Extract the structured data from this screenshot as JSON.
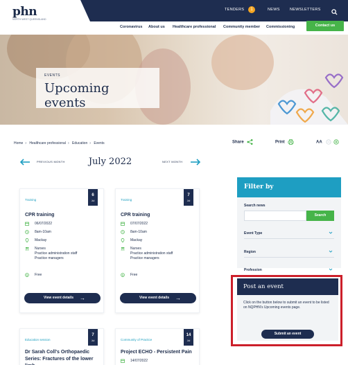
{
  "brand": {
    "logo_text": "phn",
    "logo_sub": "NORTH WEST QUEENSLAND"
  },
  "topbar": {
    "tenders_label": "TENDERS",
    "tenders_badge": "1",
    "news_label": "NEWS",
    "newsletters_label": "NEWSLETTERS"
  },
  "nav": {
    "items": [
      "Coronavirus",
      "About us",
      "Healthcare professional",
      "Community member",
      "Commissioning"
    ],
    "contact_label": "Contact us"
  },
  "hero": {
    "kicker": "EVENTS",
    "title": "Upcoming events"
  },
  "breadcrumb": [
    "Home",
    "Healthcare professional",
    "Education",
    "Events"
  ],
  "tools": {
    "share_label": "Share",
    "print_label": "Print",
    "text_size_label": "AA"
  },
  "month_nav": {
    "prev_label": "PREVIOUS MONTH",
    "title": "July 2022",
    "next_label": "NEXT MONTH"
  },
  "events": [
    {
      "category": "Training",
      "day": "6",
      "month": "Jul",
      "title": "CPR training",
      "date": "06/07/2022",
      "time": "8am-10am",
      "location": "Mackay",
      "audience": [
        "Nurses",
        "Practice administration staff",
        "Practice managers"
      ],
      "cost": "Free",
      "button_label": "View event details"
    },
    {
      "category": "Training",
      "day": "7",
      "month": "Jul",
      "title": "CPR training",
      "date": "07/07/2022",
      "time": "8am-10am",
      "location": "Mackay",
      "audience": [
        "Nurses",
        "Practice administration staff",
        "Practice managers"
      ],
      "cost": "Free",
      "button_label": "View event details"
    },
    {
      "category": "Education session",
      "day": "7",
      "month": "Jul",
      "title": "Dr Sarah Coll's Orthopaedic Series: Fractures of the lower limb"
    },
    {
      "category": "Community of Practice",
      "day": "14",
      "month": "Jul",
      "title": "Project ECHO - Persistent Pain",
      "date": "14/07/2022"
    }
  ],
  "filter": {
    "heading": "Filter by",
    "search_label": "Search news",
    "search_button": "Search",
    "selects": [
      "Event Type",
      "Region",
      "Profession"
    ]
  },
  "post_event": {
    "heading": "Post an event",
    "text": "Click on the button below to submit an event to be listed on NQPHN's Upcoming events page.",
    "button_label": "Submit an event"
  },
  "colors": {
    "navy": "#1e2d50",
    "green": "#46b449",
    "teal": "#1e9ec2",
    "highlight_red": "#cc1f2a",
    "badge_orange": "#f5a623"
  }
}
